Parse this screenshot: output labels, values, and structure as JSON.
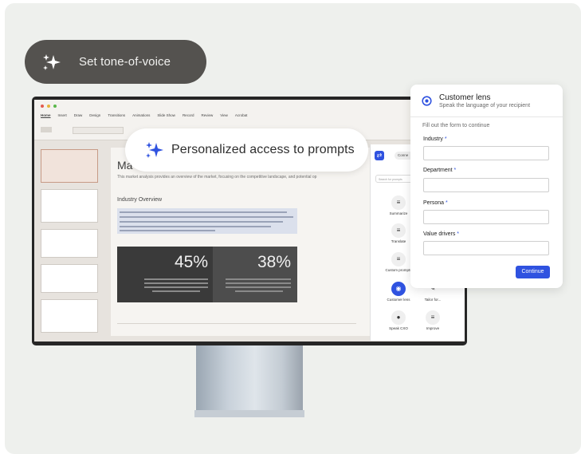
{
  "tone_pill": {
    "label": "Set tone-of-voice",
    "icon": "sparkle-icon"
  },
  "personalized_pill": {
    "label": "Personalized access to prompts",
    "icon": "sparkle-icon"
  },
  "ppt": {
    "menu": [
      "Home",
      "Insert",
      "Draw",
      "Design",
      "Transitions",
      "Animations",
      "Slide Show",
      "Record",
      "Review",
      "View",
      "Acrobat"
    ],
    "slide_title": "Ma",
    "slide_subtitle": "This market analysis provides an overview of the market, focusing on the competitive landscape, and potential op",
    "section_heading": "Industry Overview",
    "stat1": "45%",
    "stat2": "38%"
  },
  "copilot_panel": {
    "pill": "Conne",
    "search_placeholder": "Search for prompts",
    "items": [
      {
        "label": "Summarize",
        "icon": "summarize-icon"
      },
      {
        "label": "Translate",
        "icon": "translate-icon"
      },
      {
        "label": "Custom prompts",
        "icon": "custom-prompts-icon"
      },
      {
        "label": "Customer lens",
        "icon": "target-icon"
      },
      {
        "label": "Tailor for...",
        "icon": "tailor-icon"
      },
      {
        "label": "Speak CXO",
        "icon": "chat-icon"
      },
      {
        "label": "Improve",
        "icon": "improve-icon"
      }
    ]
  },
  "lens_card": {
    "title": "Customer lens",
    "subtitle": "Speak the language of your recipient",
    "intro": "Fill out the form to continue",
    "fields": [
      {
        "label": "Industry",
        "value": ""
      },
      {
        "label": "Department",
        "value": ""
      },
      {
        "label": "Persona",
        "value": ""
      },
      {
        "label": "Value drivers",
        "value": ""
      }
    ],
    "required_mark": "*",
    "continue_label": "Continue",
    "accent": "#2f52e0"
  }
}
